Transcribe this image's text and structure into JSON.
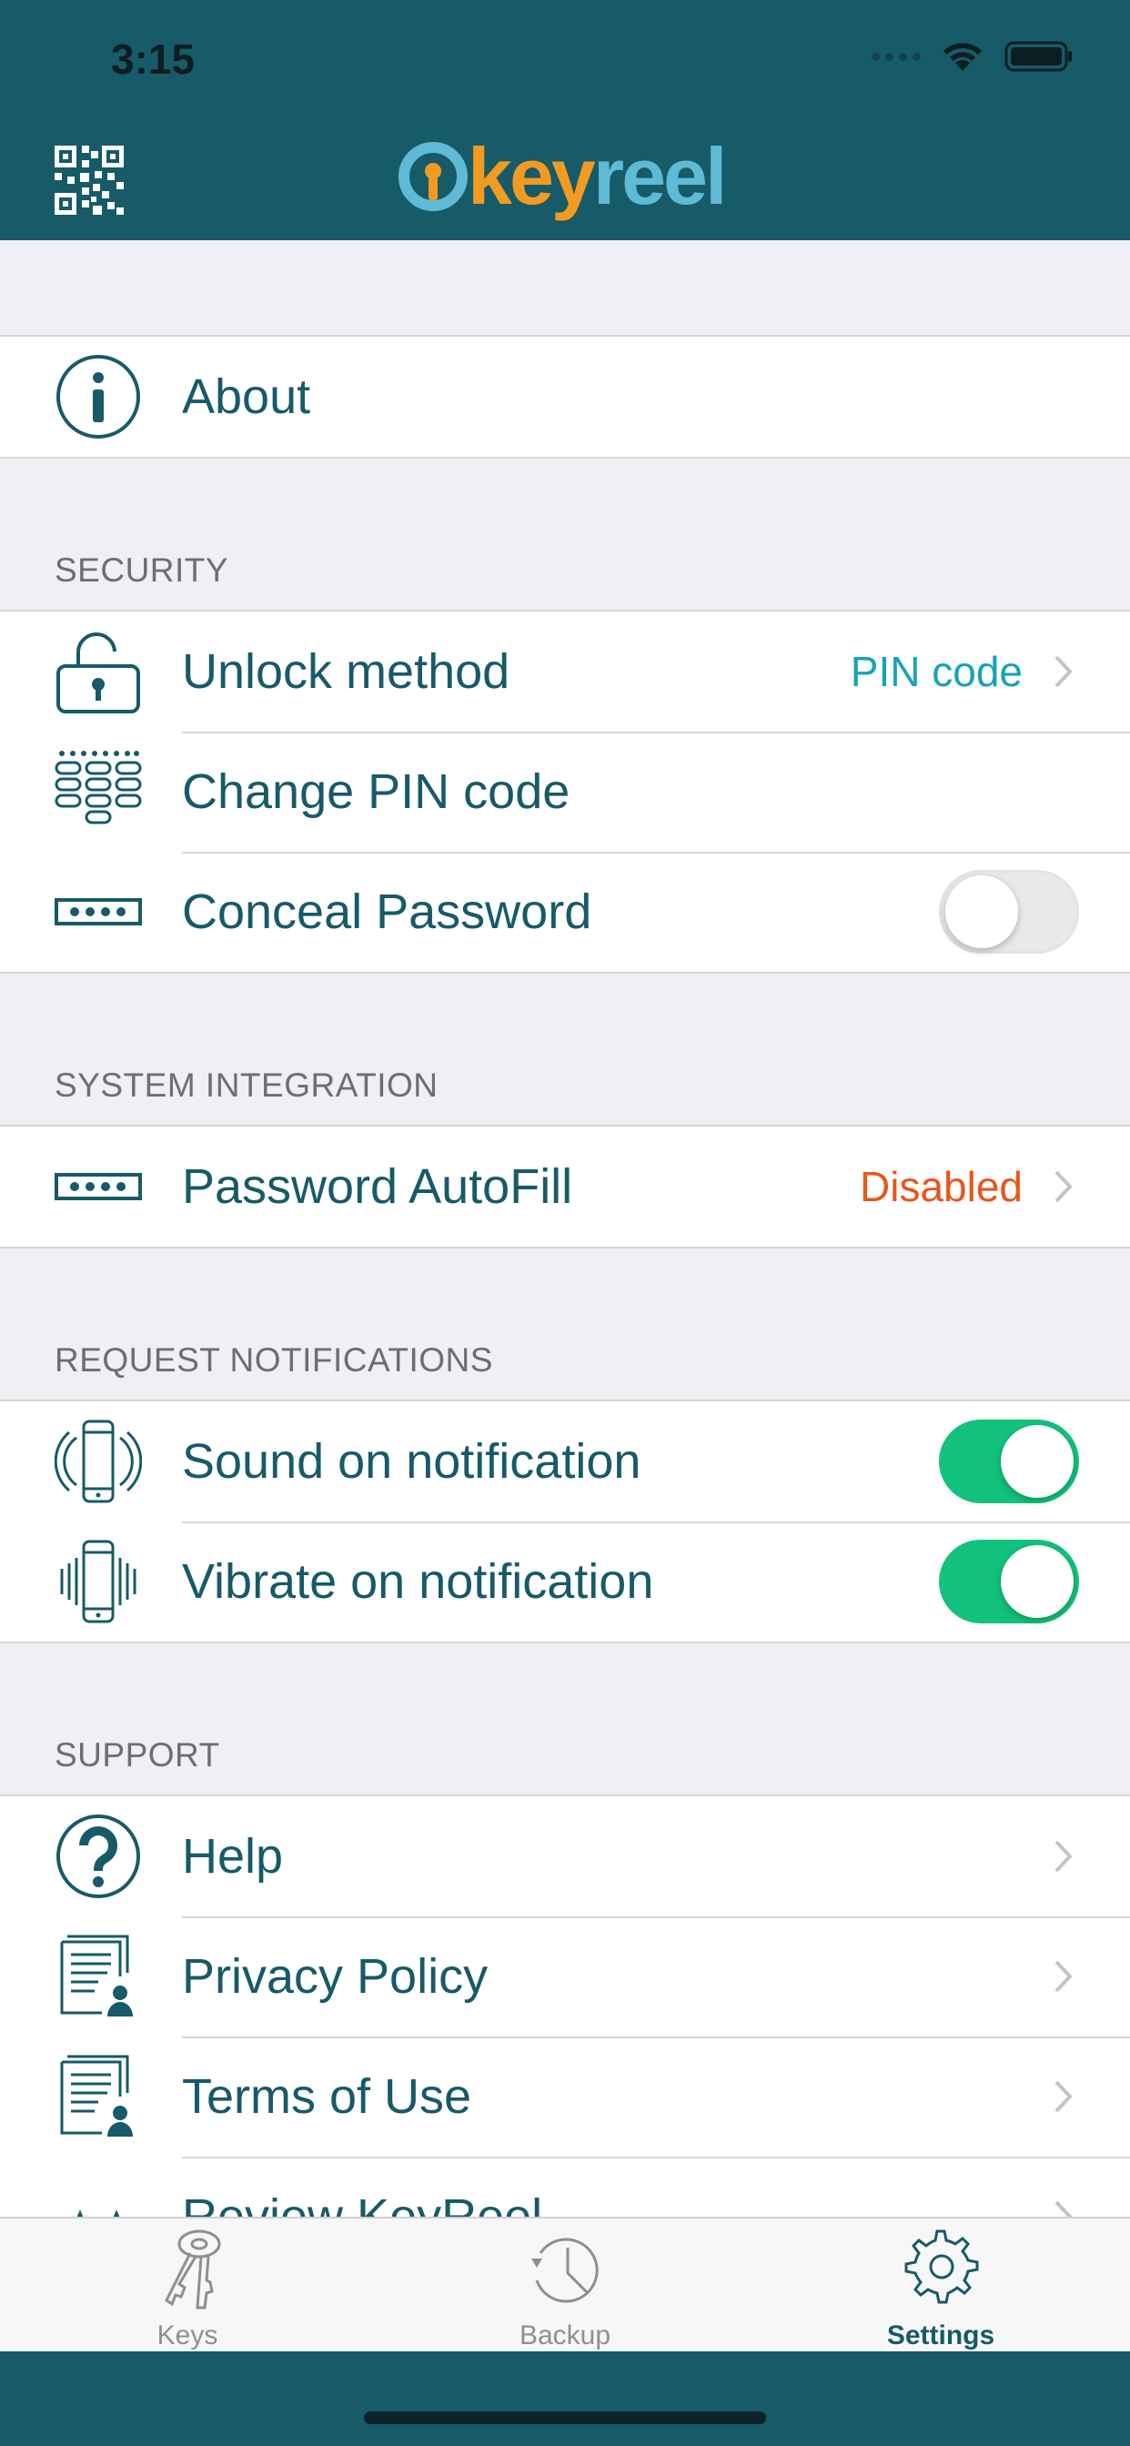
{
  "status_bar": {
    "time": "3:15"
  },
  "header": {
    "logo_part1": "key",
    "logo_part2": "reel"
  },
  "about": {
    "label": "About"
  },
  "security": {
    "header": "SECURITY",
    "unlock_label": "Unlock method",
    "unlock_value": "PIN code",
    "change_pin_label": "Change PIN code",
    "conceal_label": "Conceal Password",
    "conceal_on": false
  },
  "system": {
    "header": "SYSTEM INTEGRATION",
    "autofill_label": "Password AutoFill",
    "autofill_value": "Disabled"
  },
  "notifications": {
    "header": "REQUEST NOTIFICATIONS",
    "sound_label": "Sound on notification",
    "sound_on": true,
    "vibrate_label": "Vibrate on notification",
    "vibrate_on": true
  },
  "support": {
    "header": "SUPPORT",
    "help_label": "Help",
    "privacy_label": "Privacy Policy",
    "terms_label": "Terms of Use",
    "review_label": "Review KeyReel"
  },
  "tabbar": {
    "keys": "Keys",
    "backup": "Backup",
    "settings": "Settings",
    "active": "settings"
  },
  "colors": {
    "brand": "#175a68",
    "accent_teal": "#17a3b8",
    "accent_orange": "#e9561b",
    "toggle_on": "#12c27c",
    "logo_orange": "#f39a21",
    "logo_blue": "#5fbad6"
  }
}
